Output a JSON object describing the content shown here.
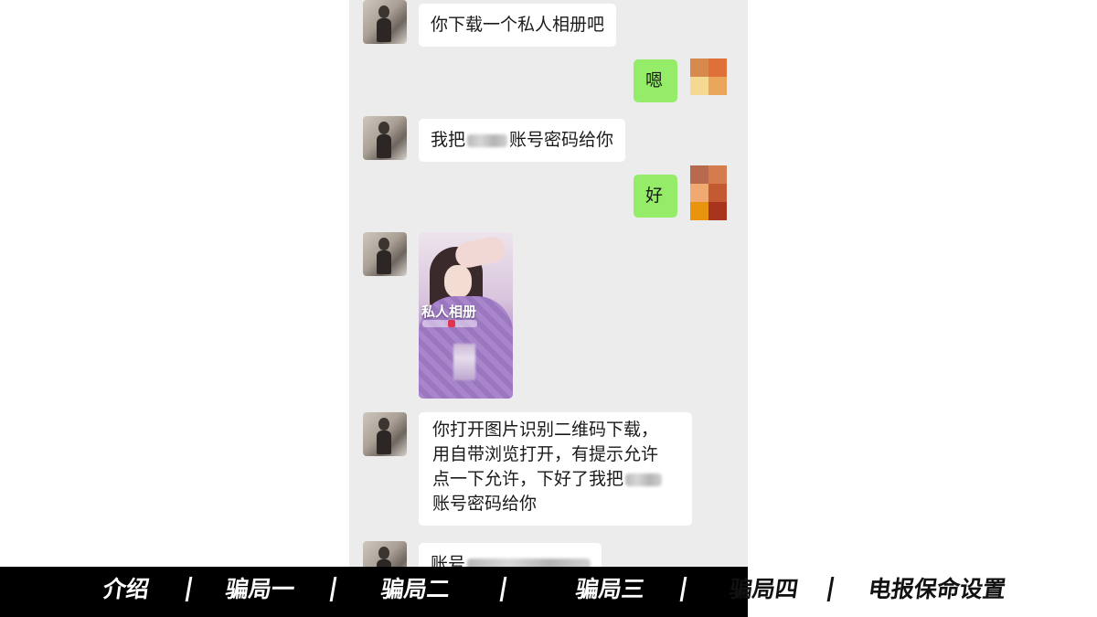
{
  "chat": {
    "messages": [
      {
        "side": "left",
        "text": "你下载一个私人相册吧"
      },
      {
        "side": "right",
        "text": "嗯"
      },
      {
        "side": "left",
        "before_blur": "我把",
        "after_blur": "账号密码给你"
      },
      {
        "side": "right",
        "text": "好"
      },
      {
        "side": "left",
        "type": "image",
        "card_title": "私人相册"
      },
      {
        "side": "left",
        "lines": [
          "你打开图片识别二维码下载，",
          "用自带浏览打开，有提示允许",
          "点一下允许，下好了我把",
          "账号密码给你"
        ]
      },
      {
        "side": "left",
        "text": "账号"
      }
    ],
    "my_avatar_colors": {
      "first": [
        "#d8894d",
        "#e0703a",
        "#f5d892",
        "#e9a55a"
      ],
      "second": [
        "#b76a4e",
        "#d57c4e",
        "#f0a970",
        "#c45a32",
        "#e8940f",
        "#a8341c"
      ]
    }
  },
  "nav": {
    "items": [
      "介绍",
      "骗局一",
      "骗局二",
      "骗局三",
      "骗局四",
      "电报保命设置"
    ]
  }
}
